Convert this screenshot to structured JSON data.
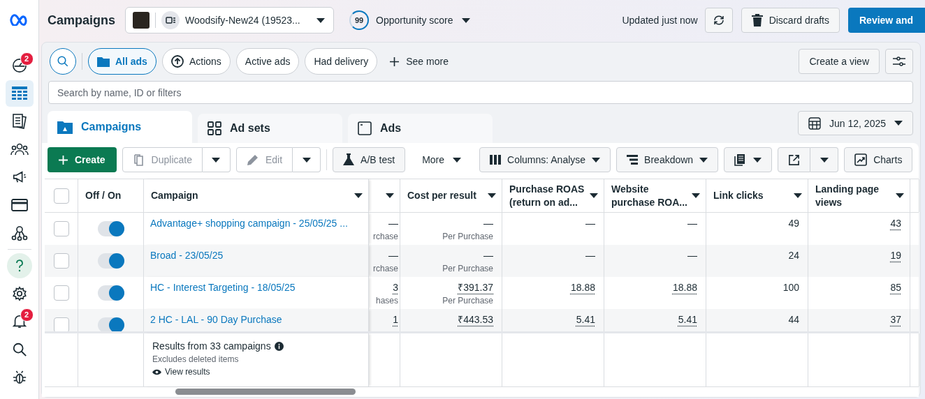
{
  "sidebar": {
    "items": [
      {
        "kind": "dashboard",
        "badge": "2",
        "selected": false
      },
      {
        "kind": "table",
        "selected": true
      },
      {
        "kind": "pages",
        "selected": false
      },
      {
        "kind": "audience",
        "selected": false
      },
      {
        "kind": "megaphone",
        "selected": false
      },
      {
        "kind": "billing",
        "selected": false
      },
      {
        "kind": "network",
        "selected": false
      },
      {
        "kind": "help",
        "selected": false
      },
      {
        "kind": "settings",
        "selected": false
      },
      {
        "kind": "notifications",
        "badge": "2",
        "selected": false
      },
      {
        "kind": "search",
        "selected": false
      },
      {
        "kind": "bug",
        "selected": false
      }
    ]
  },
  "header": {
    "title": "Campaigns",
    "account": "Woodsify-New24 (19523...",
    "score": "99",
    "score_label": "Opportunity score",
    "updated": "Updated just now",
    "discard": "Discard drafts",
    "review": "Review and"
  },
  "filters": {
    "chips": [
      {
        "label": "All ads",
        "kind": "folder",
        "selected": true
      },
      {
        "label": "Actions",
        "kind": "actions",
        "selected": false
      },
      {
        "label": "Active ads",
        "kind": "plain",
        "selected": false
      },
      {
        "label": "Had delivery",
        "kind": "plain",
        "selected": false
      }
    ],
    "see_more": "See more",
    "create_view": "Create a view"
  },
  "search": {
    "placeholder": "Search by name, ID or filters"
  },
  "tabs": [
    {
      "label": "Campaigns",
      "kind": "campaigns",
      "selected": true
    },
    {
      "label": "Ad sets",
      "kind": "adsets",
      "selected": false
    },
    {
      "label": "Ads",
      "kind": "ads",
      "selected": false
    }
  ],
  "date": "Jun 12, 2025",
  "toolbar": {
    "create": "Create",
    "duplicate": {
      "label": "Duplicate",
      "disabled": true
    },
    "edit": {
      "label": "Edit",
      "disabled": true
    },
    "ab_test": "A/B test",
    "more": "More",
    "columns": "Columns: Analyse",
    "breakdown": "Breakdown",
    "charts": "Charts"
  },
  "table": {
    "all_checked": false,
    "columns": [
      {
        "label": "Off / On"
      },
      {
        "label": "Campaign"
      },
      {},
      {
        "label": "Cost per result"
      },
      {
        "label": "Purchase ROAS (return on ad..."
      },
      {
        "label": "Website purchase ROA..."
      },
      {
        "label": "Link clicks"
      },
      {
        "label": "Landing page views"
      }
    ],
    "rows": [
      {
        "selected": false,
        "cells": [
          {
            "kind": "toggle",
            "on": true
          },
          {
            "kind": "link",
            "value": "Advantage+ shopping campaign - 25/05/25 ..."
          },
          {
            "kind": "metric",
            "value": "—",
            "sub": "rchase",
            "underlined": false
          },
          {
            "kind": "metric",
            "value": "—",
            "sub": "Per Purchase",
            "underlined": false
          },
          {
            "kind": "metric",
            "value": "—",
            "underlined": false
          },
          {
            "kind": "metric",
            "value": "—",
            "underlined": false
          },
          {
            "kind": "metric",
            "value": "49",
            "underlined": false
          },
          {
            "kind": "metric",
            "value": "43",
            "underlined": true
          }
        ]
      },
      {
        "selected": false,
        "cells": [
          {
            "kind": "toggle",
            "on": true
          },
          {
            "kind": "link",
            "value": "Broad - 23/05/25"
          },
          {
            "kind": "metric",
            "value": "—",
            "sub": "rchase",
            "underlined": false
          },
          {
            "kind": "metric",
            "value": "—",
            "sub": "Per Purchase",
            "underlined": false
          },
          {
            "kind": "metric",
            "value": "—",
            "underlined": false
          },
          {
            "kind": "metric",
            "value": "—",
            "underlined": false
          },
          {
            "kind": "metric",
            "value": "24",
            "underlined": false
          },
          {
            "kind": "metric",
            "value": "19",
            "underlined": true
          }
        ]
      },
      {
        "selected": false,
        "cells": [
          {
            "kind": "toggle",
            "on": true
          },
          {
            "kind": "link",
            "value": "HC - Interest Targeting - 18/05/25"
          },
          {
            "kind": "metric",
            "value": "3",
            "sub": "hases",
            "underlined": true
          },
          {
            "kind": "metric",
            "value": "₹391.37",
            "sub": "Per Purchase",
            "underlined": true
          },
          {
            "kind": "metric",
            "value": "18.88",
            "underlined": true
          },
          {
            "kind": "metric",
            "value": "18.88",
            "underlined": true
          },
          {
            "kind": "metric",
            "value": "100",
            "underlined": false
          },
          {
            "kind": "metric",
            "value": "85",
            "underlined": true
          }
        ]
      },
      {
        "selected": false,
        "cells": [
          {
            "kind": "toggle",
            "on": true
          },
          {
            "kind": "link",
            "value": "2 HC - LAL - 90 Day Purchase"
          },
          {
            "kind": "metric",
            "value": "1",
            "underlined": true
          },
          {
            "kind": "metric",
            "value": "₹443.53",
            "underlined": true
          },
          {
            "kind": "metric",
            "value": "5.41",
            "underlined": true
          },
          {
            "kind": "metric",
            "value": "5.41",
            "underlined": true
          },
          {
            "kind": "metric",
            "value": "44",
            "underlined": false
          },
          {
            "kind": "metric",
            "value": "37",
            "underlined": true
          }
        ]
      }
    ],
    "footer": {
      "summary": "Results from 33 campaigns",
      "note": "Excludes deleted items",
      "link": "View results"
    }
  }
}
